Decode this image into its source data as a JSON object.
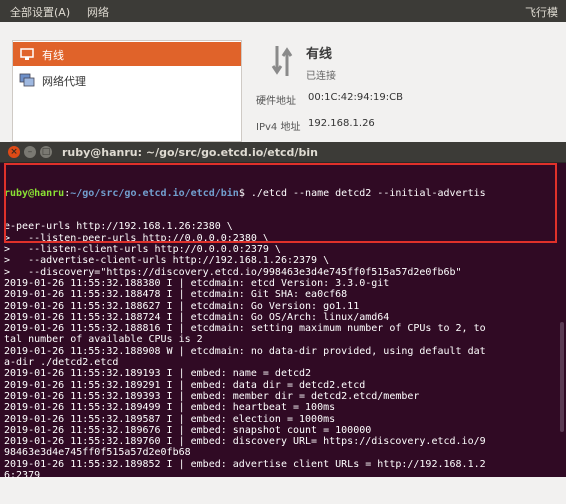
{
  "menubar": {
    "item1": "全部设置(A)",
    "item2": "网络",
    "right": "飞行模"
  },
  "settings": {
    "sidebar": {
      "items": [
        {
          "label": "有线",
          "icon": "wired-network-icon",
          "selected": true
        },
        {
          "label": "网络代理",
          "icon": "network-proxy-icon",
          "selected": false
        }
      ]
    },
    "wired": {
      "title": "有线",
      "status": "已连接",
      "hw_label": "硬件地址",
      "hw_value": "00:1C:42:94:19:CB",
      "ipv4_label": "IPv4 地址",
      "ipv4_value": "192.168.1.26"
    },
    "accent_color": "#e0632a"
  },
  "terminal": {
    "title": "ruby@hanru: ~/go/src/go.etcd.io/etcd/bin",
    "prompt_user": "ruby@hanru",
    "prompt_sep": ":",
    "prompt_path": "~/go/src/go.etcd.io/etcd/bin",
    "prompt_end": "$ ",
    "command_first": "./etcd --name detcd2 --initial-advertis",
    "lines": [
      "e-peer-urls http://192.168.1.26:2380 \\",
      ">   --listen-peer-urls http://0.0.0.0:2380 \\",
      ">   --listen-client-urls http://0.0.0.0:2379 \\",
      ">   --advertise-client-urls http://192.168.1.26:2379 \\",
      ">   --discovery=\"https://discovery.etcd.io/998463e3d4e745ff0f515a57d2e0fb6b\"",
      "2019-01-26 11:55:32.188380 I | etcdmain: etcd Version: 3.3.0-git",
      "2019-01-26 11:55:32.188478 I | etcdmain: Git SHA: ea0cf68",
      "2019-01-26 11:55:32.188627 I | etcdmain: Go Version: go1.11",
      "2019-01-26 11:55:32.188724 I | etcdmain: Go OS/Arch: linux/amd64",
      "2019-01-26 11:55:32.188816 I | etcdmain: setting maximum number of CPUs to 2, to",
      "tal number of available CPUs is 2",
      "2019-01-26 11:55:32.188908 W | etcdmain: no data-dir provided, using default dat",
      "a-dir ./detcd2.etcd",
      "2019-01-26 11:55:32.189193 I | embed: name = detcd2",
      "2019-01-26 11:55:32.189291 I | embed: data dir = detcd2.etcd",
      "2019-01-26 11:55:32.189393 I | embed: member dir = detcd2.etcd/member",
      "2019-01-26 11:55:32.189499 I | embed: heartbeat = 100ms",
      "2019-01-26 11:55:32.189587 I | embed: election = 1000ms",
      "2019-01-26 11:55:32.189676 I | embed: snapshot count = 100000",
      "2019-01-26 11:55:32.189760 I | embed: discovery URL= https://discovery.etcd.io/9",
      "98463e3d4e745ff0f515a57d2e0fb68",
      "2019-01-26 11:55:32.189852 I | embed: advertise client URLs = http://192.168.1.2",
      "6:2379"
    ],
    "colors": {
      "background": "#300a24",
      "prompt_user": "#8ae234",
      "prompt_path": "#729fcf",
      "highlight_box": "#e0312a"
    }
  }
}
